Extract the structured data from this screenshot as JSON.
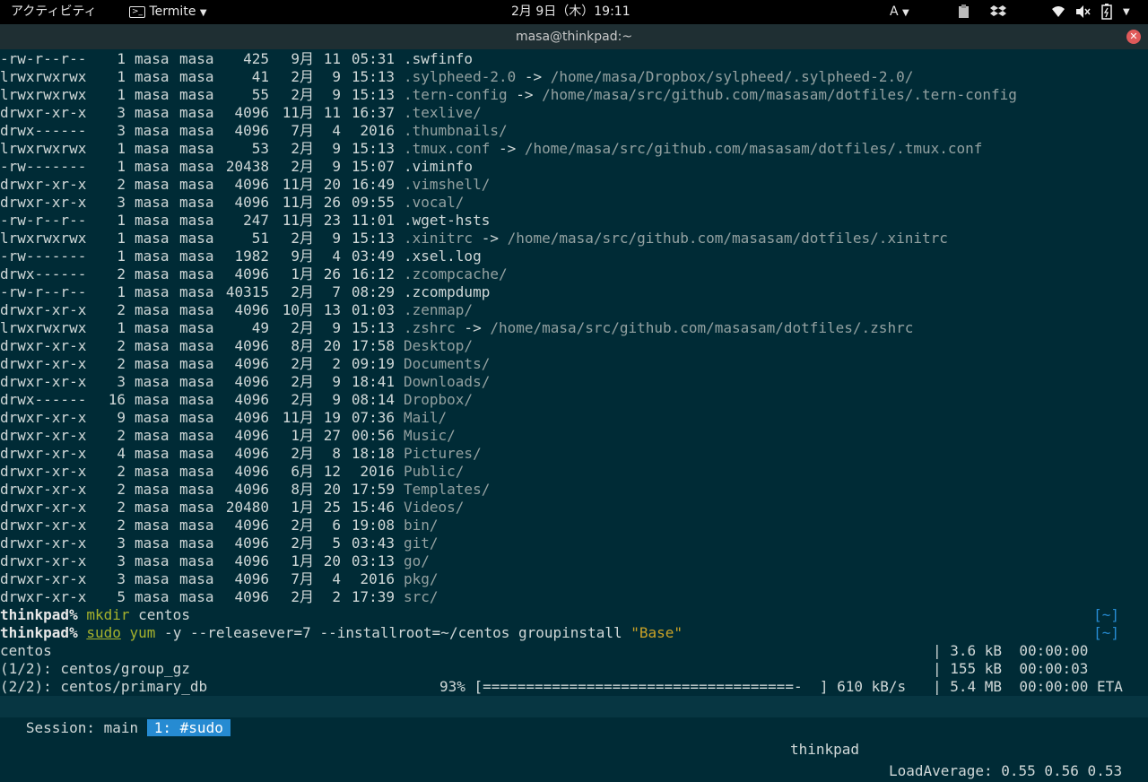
{
  "topbar": {
    "activities": "アクティビティ",
    "app_name": "Termite",
    "clock": "2月 9日（木）19:11",
    "input_method": "A"
  },
  "window": {
    "title": "masa@thinkpad:~"
  },
  "listing": [
    {
      "perm": "-rw-r--r--",
      "links": "1",
      "owner": "masa",
      "group": "masa",
      "size": "425",
      "month": "9月",
      "day": "11",
      "time": "05:31",
      "name": ".swfinfo",
      "type": "file"
    },
    {
      "perm": "lrwxrwxrwx",
      "links": "1",
      "owner": "masa",
      "group": "masa",
      "size": "41",
      "month": "2月",
      "day": "9",
      "time": "15:13",
      "name": ".sylpheed-2.0",
      "type": "link",
      "target": "/home/masa/Dropbox/sylpheed/.sylpheed-2.0/"
    },
    {
      "perm": "lrwxrwxrwx",
      "links": "1",
      "owner": "masa",
      "group": "masa",
      "size": "55",
      "month": "2月",
      "day": "9",
      "time": "15:13",
      "name": ".tern-config",
      "type": "link",
      "target": "/home/masa/src/github.com/masasam/dotfiles/.tern-config"
    },
    {
      "perm": "drwxr-xr-x",
      "links": "3",
      "owner": "masa",
      "group": "masa",
      "size": "4096",
      "month": "11月",
      "day": "11",
      "time": "16:37",
      "name": ".texlive/",
      "type": "dir"
    },
    {
      "perm": "drwx------",
      "links": "3",
      "owner": "masa",
      "group": "masa",
      "size": "4096",
      "month": "7月",
      "day": "4",
      "time": "2016",
      "name": ".thumbnails/",
      "type": "dir"
    },
    {
      "perm": "lrwxrwxrwx",
      "links": "1",
      "owner": "masa",
      "group": "masa",
      "size": "53",
      "month": "2月",
      "day": "9",
      "time": "15:13",
      "name": ".tmux.conf",
      "type": "link",
      "target": "/home/masa/src/github.com/masasam/dotfiles/.tmux.conf"
    },
    {
      "perm": "-rw-------",
      "links": "1",
      "owner": "masa",
      "group": "masa",
      "size": "20438",
      "month": "2月",
      "day": "9",
      "time": "15:07",
      "name": ".viminfo",
      "type": "file"
    },
    {
      "perm": "drwxr-xr-x",
      "links": "2",
      "owner": "masa",
      "group": "masa",
      "size": "4096",
      "month": "11月",
      "day": "20",
      "time": "16:49",
      "name": ".vimshell/",
      "type": "dir"
    },
    {
      "perm": "drwxr-xr-x",
      "links": "3",
      "owner": "masa",
      "group": "masa",
      "size": "4096",
      "month": "11月",
      "day": "26",
      "time": "09:55",
      "name": ".vocal/",
      "type": "dir"
    },
    {
      "perm": "-rw-r--r--",
      "links": "1",
      "owner": "masa",
      "group": "masa",
      "size": "247",
      "month": "11月",
      "day": "23",
      "time": "11:01",
      "name": ".wget-hsts",
      "type": "file"
    },
    {
      "perm": "lrwxrwxrwx",
      "links": "1",
      "owner": "masa",
      "group": "masa",
      "size": "51",
      "month": "2月",
      "day": "9",
      "time": "15:13",
      "name": ".xinitrc",
      "type": "link",
      "target": "/home/masa/src/github.com/masasam/dotfiles/.xinitrc"
    },
    {
      "perm": "-rw-------",
      "links": "1",
      "owner": "masa",
      "group": "masa",
      "size": "1982",
      "month": "9月",
      "day": "4",
      "time": "03:49",
      "name": ".xsel.log",
      "type": "file"
    },
    {
      "perm": "drwx------",
      "links": "2",
      "owner": "masa",
      "group": "masa",
      "size": "4096",
      "month": "1月",
      "day": "26",
      "time": "16:12",
      "name": ".zcompcache/",
      "type": "dir"
    },
    {
      "perm": "-rw-r--r--",
      "links": "1",
      "owner": "masa",
      "group": "masa",
      "size": "40315",
      "month": "2月",
      "day": "7",
      "time": "08:29",
      "name": ".zcompdump",
      "type": "file"
    },
    {
      "perm": "drwxr-xr-x",
      "links": "2",
      "owner": "masa",
      "group": "masa",
      "size": "4096",
      "month": "10月",
      "day": "13",
      "time": "01:03",
      "name": ".zenmap/",
      "type": "dir"
    },
    {
      "perm": "lrwxrwxrwx",
      "links": "1",
      "owner": "masa",
      "group": "masa",
      "size": "49",
      "month": "2月",
      "day": "9",
      "time": "15:13",
      "name": ".zshrc",
      "type": "link",
      "target": "/home/masa/src/github.com/masasam/dotfiles/.zshrc"
    },
    {
      "perm": "drwxr-xr-x",
      "links": "2",
      "owner": "masa",
      "group": "masa",
      "size": "4096",
      "month": "8月",
      "day": "20",
      "time": "17:58",
      "name": "Desktop/",
      "type": "dir"
    },
    {
      "perm": "drwxr-xr-x",
      "links": "2",
      "owner": "masa",
      "group": "masa",
      "size": "4096",
      "month": "2月",
      "day": "2",
      "time": "09:19",
      "name": "Documents/",
      "type": "dir"
    },
    {
      "perm": "drwxr-xr-x",
      "links": "3",
      "owner": "masa",
      "group": "masa",
      "size": "4096",
      "month": "2月",
      "day": "9",
      "time": "18:41",
      "name": "Downloads/",
      "type": "dir"
    },
    {
      "perm": "drwx------",
      "links": "16",
      "owner": "masa",
      "group": "masa",
      "size": "4096",
      "month": "2月",
      "day": "9",
      "time": "08:14",
      "name": "Dropbox/",
      "type": "dir"
    },
    {
      "perm": "drwxr-xr-x",
      "links": "9",
      "owner": "masa",
      "group": "masa",
      "size": "4096",
      "month": "11月",
      "day": "19",
      "time": "07:36",
      "name": "Mail/",
      "type": "dir"
    },
    {
      "perm": "drwxr-xr-x",
      "links": "2",
      "owner": "masa",
      "group": "masa",
      "size": "4096",
      "month": "1月",
      "day": "27",
      "time": "00:56",
      "name": "Music/",
      "type": "dir"
    },
    {
      "perm": "drwxr-xr-x",
      "links": "4",
      "owner": "masa",
      "group": "masa",
      "size": "4096",
      "month": "2月",
      "day": "8",
      "time": "18:18",
      "name": "Pictures/",
      "type": "dir"
    },
    {
      "perm": "drwxr-xr-x",
      "links": "2",
      "owner": "masa",
      "group": "masa",
      "size": "4096",
      "month": "6月",
      "day": "12",
      "time": "2016",
      "name": "Public/",
      "type": "dir"
    },
    {
      "perm": "drwxr-xr-x",
      "links": "2",
      "owner": "masa",
      "group": "masa",
      "size": "4096",
      "month": "8月",
      "day": "20",
      "time": "17:59",
      "name": "Templates/",
      "type": "dir"
    },
    {
      "perm": "drwxr-xr-x",
      "links": "2",
      "owner": "masa",
      "group": "masa",
      "size": "20480",
      "month": "1月",
      "day": "25",
      "time": "15:46",
      "name": "Videos/",
      "type": "dir"
    },
    {
      "perm": "drwxr-xr-x",
      "links": "2",
      "owner": "masa",
      "group": "masa",
      "size": "4096",
      "month": "2月",
      "day": "6",
      "time": "19:08",
      "name": "bin/",
      "type": "dir"
    },
    {
      "perm": "drwxr-xr-x",
      "links": "3",
      "owner": "masa",
      "group": "masa",
      "size": "4096",
      "month": "2月",
      "day": "5",
      "time": "03:43",
      "name": "git/",
      "type": "dir"
    },
    {
      "perm": "drwxr-xr-x",
      "links": "3",
      "owner": "masa",
      "group": "masa",
      "size": "4096",
      "month": "1月",
      "day": "20",
      "time": "03:13",
      "name": "go/",
      "type": "dir"
    },
    {
      "perm": "drwxr-xr-x",
      "links": "3",
      "owner": "masa",
      "group": "masa",
      "size": "4096",
      "month": "7月",
      "day": "4",
      "time": "2016",
      "name": "pkg/",
      "type": "dir"
    },
    {
      "perm": "drwxr-xr-x",
      "links": "5",
      "owner": "masa",
      "group": "masa",
      "size": "4096",
      "month": "2月",
      "day": "2",
      "time": "17:39",
      "name": "src/",
      "type": "dir"
    }
  ],
  "commands": [
    {
      "host": "thinkpad%",
      "parts": [
        {
          "text": "mkdir",
          "cls": "cmd"
        },
        {
          "text": " centos",
          "cls": ""
        }
      ],
      "rprompt": "[~]"
    },
    {
      "host": "thinkpad%",
      "parts": [
        {
          "text": "sudo",
          "cls": "sudo"
        },
        {
          "text": " ",
          "cls": ""
        },
        {
          "text": "yum",
          "cls": "cmd"
        },
        {
          "text": " -y --releasever=7 --installroot=~/centos groupinstall ",
          "cls": ""
        },
        {
          "text": "\"Base\"",
          "cls": "str"
        }
      ],
      "rprompt": "[~]"
    }
  ],
  "downloads": [
    {
      "left": "centos",
      "middle": "",
      "right": "| 3.6 kB  00:00:00"
    },
    {
      "left": "(1/2): centos/group_gz",
      "middle": "",
      "right": "| 155 kB  00:00:03"
    },
    {
      "left": "(2/2): centos/primary_db",
      "middle": "93% [====================================-  ] 610 kB/s",
      "right": "| 5.4 MB  00:00:00 ETA"
    }
  ],
  "statusbar": {
    "session": " Session: main ",
    "window": "1: #sudo",
    "host": "thinkpad",
    "load": "LoadAverage: 0.55 0.56 0.53"
  }
}
